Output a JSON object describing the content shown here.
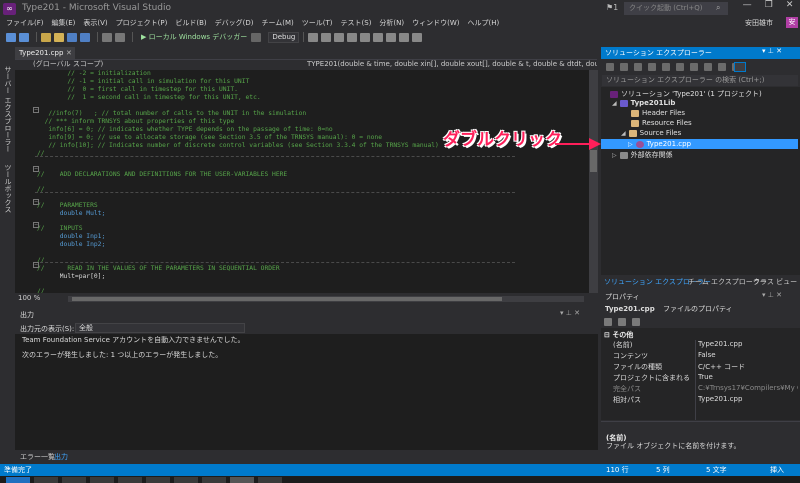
{
  "window": {
    "title": "Type201 - Microsoft Visual Studio",
    "quick_launch_placeholder": "クイック起動 (Ctrl+Q)",
    "notification_count": "1",
    "user_name": "安田雄市",
    "user_initial": "安"
  },
  "menu": [
    "ファイル(F)",
    "編集(E)",
    "表示(V)",
    "プロジェクト(P)",
    "ビルド(B)",
    "デバッグ(D)",
    "チーム(M)",
    "ツール(T)",
    "テスト(S)",
    "分析(N)",
    "ウィンドウ(W)",
    "ヘルプ(H)"
  ],
  "toolbar": {
    "run_label": "▶ ローカル Windows デバッガー",
    "config": "Debug"
  },
  "left_tabs": [
    "サーバー エクスプローラー",
    "ツールボックス"
  ],
  "editor": {
    "tab": "Type201.cpp",
    "nav_left": "(グローバル スコープ)",
    "nav_right": "TYPE201(double & time, double xin[], double xout[], double & t, double & dtdt, doub",
    "zoom": "100 %",
    "lines": [
      "        // -2 = initialization",
      "        // -1 = initial call in simulation for this UNIT",
      "        //  0 = first call in timestep for this UNIT.",
      "        //  1 = second call in timestep for this UNIT, etc.",
      "",
      "   //info(7)   ; // total number of calls to the UNIT in the simulation",
      "  // *** inform TRNSYS about properties of this type",
      "   info[6] = 0; // indicates whether TYPE depends on the passage of time: 0=no",
      "   info[9] = 0; // use to allocate storage (see Section 3.5 of the TRNSYS manual): 0 = none",
      "   // info[10]; // Indicates number of discrete control variables (see Section 3.3.4 of the TRNSYS manual)",
      "//",
      "",
      "//    ADD DECLARATIONS AND DEFINITIONS FOR THE USER-VARIABLES HERE",
      "",
      "//",
      "",
      "//    PARAMETERS",
      "      double Mult;",
      "",
      "//    INPUTS",
      "      double Inp1;",
      "      double Inp2;",
      "",
      "//",
      "//      READ IN THE VALUES OF THE PARAMETERS IN SEQUENTIAL ORDER",
      "      Mult=par[0];",
      "",
      "//"
    ]
  },
  "output": {
    "title": "出力",
    "source_label": "出力元の表示(S):",
    "source_value": "全般",
    "lines": [
      "Team Foundation Service アカウントを自動入力できませんでした。",
      "",
      "次のエラーが発生しました: 1 つ以上のエラーが発生しました。"
    ],
    "tabs": [
      "エラー一覧",
      "出力"
    ]
  },
  "solution_explorer": {
    "title": "ソリューション エクスプローラー",
    "search_placeholder": "ソリューション エクスプローラー の検索 (Ctrl+;)",
    "nodes": {
      "solution": "ソリューション 'Type201' (1 プロジェクト)",
      "project": "Type201Lib",
      "header_files": "Header Files",
      "resource_files": "Resource Files",
      "source_files": "Source Files",
      "file": "Type201.cpp",
      "external": "外部依存関係"
    },
    "tabs": [
      "ソリューション エクスプローラー",
      "チーム エクスプローラー",
      "クラス ビュー"
    ]
  },
  "properties": {
    "title": "プロパティ",
    "object": "Type201.cpp",
    "object_type": "ファイルのプロパティ",
    "category": "その他",
    "rows": [
      {
        "name": "(名前)",
        "value": "Type201.cpp"
      },
      {
        "name": "コンテンツ",
        "value": "False"
      },
      {
        "name": "ファイルの種類",
        "value": "C/C++ コード"
      },
      {
        "name": "プロジェクトに含まれる",
        "value": "True"
      },
      {
        "name": "完全パス",
        "value": "C:¥Trnsys17¥Compilers¥My C"
      },
      {
        "name": "相対パス",
        "value": "Type201.cpp"
      }
    ],
    "desc_name": "(名前)",
    "desc_text": "ファイル オブジェクトに名前を付けます。"
  },
  "statusbar": {
    "ready": "準備完了",
    "line": "110 行",
    "col": "5 列",
    "char": "5 文字",
    "mode": "挿入"
  },
  "annotation": {
    "text": "ダブルクリック",
    "color": "#ff1f5a"
  },
  "colors": {
    "accent": "#007acc",
    "comment": "#57a64a",
    "keyword": "#569cd6",
    "selection": "#3399ff"
  }
}
